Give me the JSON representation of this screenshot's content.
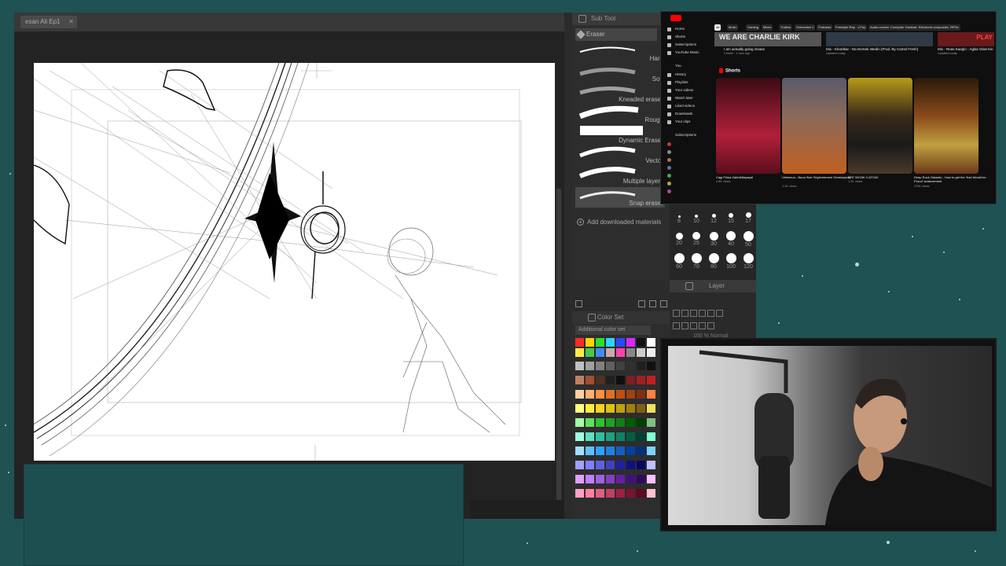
{
  "app": {
    "tab_title": "esan Ali Ep1",
    "subtool_title": "Sub Tool",
    "eraser_tab": "Eraser",
    "brushes": [
      {
        "label": "Hard"
      },
      {
        "label": "Soft"
      },
      {
        "label": "Kneaded eraser"
      },
      {
        "label": "Rough"
      },
      {
        "label": "Dynamic Eraser"
      },
      {
        "label": "Vector"
      },
      {
        "label": "Multiple layers"
      },
      {
        "label": "Snap eraser",
        "selected": true
      }
    ],
    "add_downloaded": "Add downloaded materials",
    "brush_sizes": [
      "8",
      "10",
      "12",
      "15",
      "17",
      "20",
      "25",
      "30",
      "40",
      "50",
      "60",
      "70",
      "80",
      "100",
      "120"
    ],
    "layer_title": "Layer",
    "layer_opacity": "100 % Normal",
    "colorset_title": "Color Set",
    "colorset_select": "Additional color set"
  },
  "youtube": {
    "hero_title": "WE ARE CHARLIE KIRK",
    "side_items": [
      "Home",
      "Shorts",
      "Subscriptions",
      "YouTube Music",
      "You",
      "History",
      "Playlists",
      "Your videos",
      "Watch later",
      "Liked videos",
      "Downloads",
      "Your clips",
      "Subscriptions"
    ],
    "chips": [
      "All",
      "Music",
      "Gaming",
      "Mixes",
      "Trailers",
      "Overwatch 2",
      "Podcasts",
      "Freestyle Rap",
      "J-Pop",
      "Audio commentaries",
      "Computer Hardware",
      "Electronic compositions",
      "RPGs"
    ],
    "videos": [
      {
        "title": "I am actually going insane",
        "meta": "Charlie · 1 hour ago"
      },
      {
        "title": "Mix - Khontkar - Na Demek Istedin (Prod. By Camel Fresh)",
        "meta": "Updated today"
      },
      {
        "title": "Mix - Reas Kaeglo - Aglas Gbat Kin",
        "meta": "Updated today"
      }
    ],
    "shorts_label": "Shorts",
    "shorts": [
      {
        "title": "Cagi Firina Zafer&Bayapal",
        "meta": "4.8K views"
      },
      {
        "title": "Videonun - Buna Size Söylememem Gereksiymiş",
        "meta": "1.1K views"
      },
      {
        "title": "EFE SHOW X ATO42",
        "meta": "1.2K views"
      },
      {
        "title": "Deep Rock Galactic - How to get the 'Karl Would be Proud' achievement",
        "meta": "370K views"
      }
    ]
  },
  "colors": {
    "background": "#1f5253",
    "panel": "#2d2d2d",
    "accent_red": "#ff0000"
  }
}
